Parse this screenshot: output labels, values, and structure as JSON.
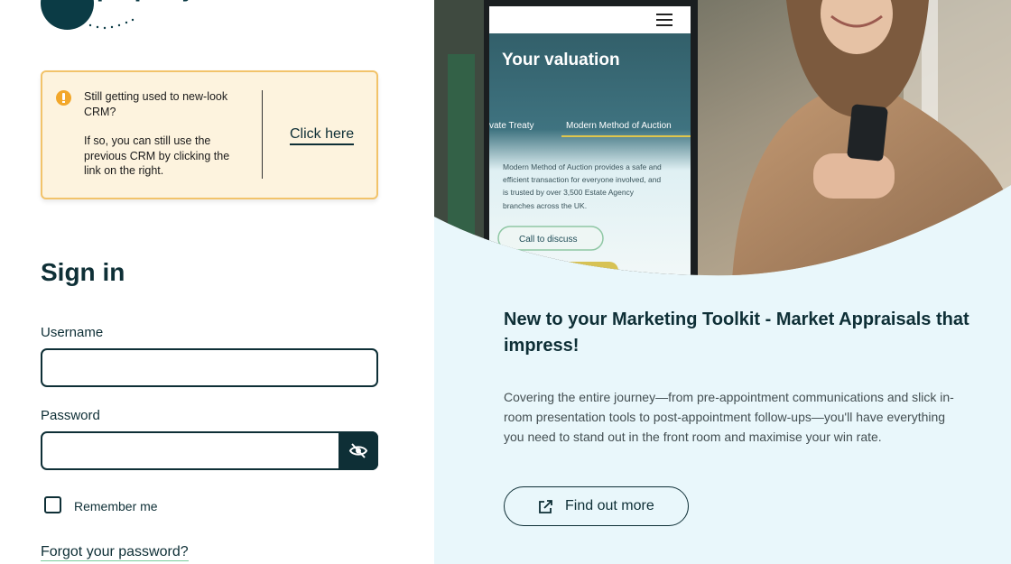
{
  "brand": {
    "logo_word_1": "iam",
    "logo_word_2": "property"
  },
  "notice": {
    "line1": "Still getting used to new-look CRM?",
    "line2": "If so, you can still use the previous CRM by clicking the link on the right.",
    "link_label": "Click here"
  },
  "signin": {
    "title": "Sign in",
    "username_label": "Username",
    "username_value": "",
    "password_label": "Password",
    "password_value": "",
    "remember_label": "Remember me",
    "remember_checked": false,
    "forgot_label": "Forgot your password?"
  },
  "hero_phone": {
    "heading": "Your valuation",
    "tab_left": "vate Treaty",
    "tab_right": "Modern Method of Auction",
    "body_lines": [
      "Modern Method of Auction provides a safe and",
      "efficient transaction for everyone involved, and",
      "is trusted by over 3,500 Estate Agency",
      "branches across the UK."
    ],
    "button": "Call to discuss"
  },
  "promo": {
    "title": "New to your Marketing Toolkit - Market Appraisals that impress!",
    "body": "Covering the entire journey—from pre-appointment communications and slick in-room presentation tools to post-appointment follow-ups—you'll have everything you need to stand out in the front room and maximise your win rate.",
    "cta_label": "Find out more"
  },
  "colors": {
    "brand_dark": "#0e2f36",
    "notice_bg": "#fdf3de",
    "notice_border": "#f2c36a",
    "info_icon": "#f2a72a",
    "right_panel_bg": "#e9f7fb",
    "link_underline": "#7acc9b"
  },
  "icons": {
    "info": "info-icon",
    "password_toggle": "eye-slash-icon",
    "external_link": "external-link-icon",
    "menu": "hamburger-menu-icon"
  }
}
